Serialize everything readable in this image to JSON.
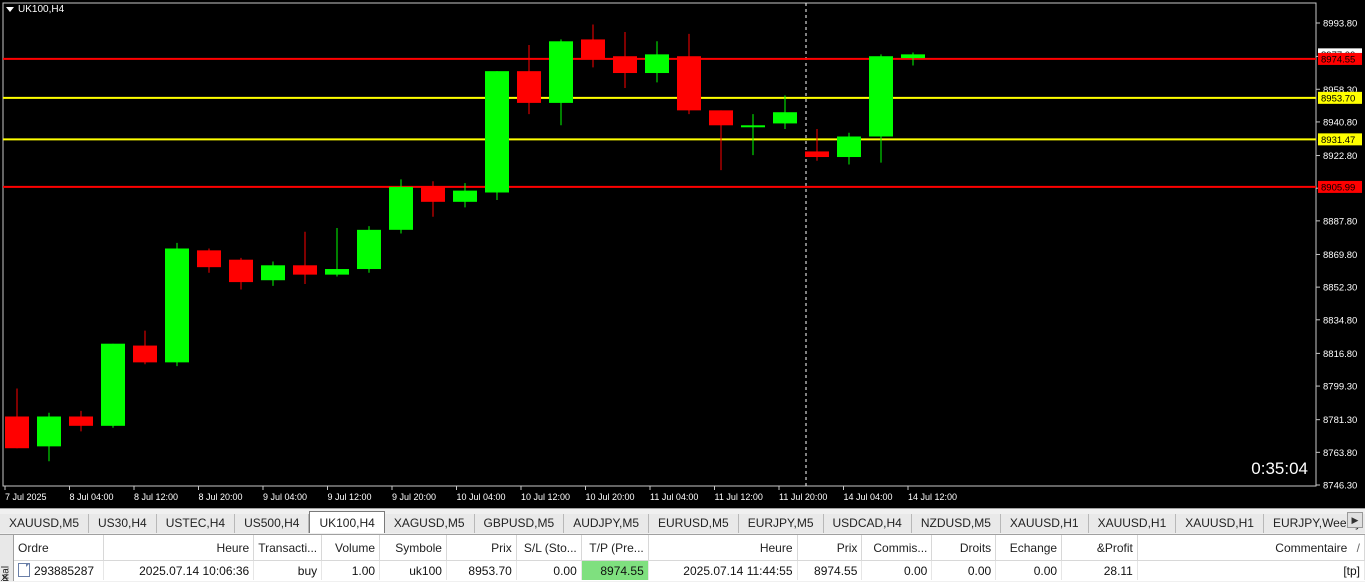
{
  "chart": {
    "symbol_label": "UK100,H4",
    "countdown": "0:35:04",
    "colors": {
      "background": "#000000",
      "bull": "#00ff00",
      "bear": "#ff0000",
      "grid_text": "#ffffff",
      "red_level": "#ff0000",
      "yellow_level": "#ffff00"
    }
  },
  "chart_data": {
    "type": "candlestick",
    "title": "UK100,H4",
    "y_ticks": [
      "8993.80",
      "8975.90",
      "8958.30",
      "8940.80",
      "8922.80",
      "8905.30",
      "8887.80",
      "8869.80",
      "8852.30",
      "8834.80",
      "8816.80",
      "8799.30",
      "8781.30",
      "8763.80",
      "8746.30"
    ],
    "x_labels": [
      "7 Jul 2025",
      "8 Jul 04:00",
      "8 Jul 12:00",
      "8 Jul 20:00",
      "9 Jul 04:00",
      "9 Jul 12:00",
      "9 Jul 20:00",
      "10 Jul 04:00",
      "10 Jul 12:00",
      "10 Jul 20:00",
      "11 Jul 04:00",
      "11 Jul 12:00",
      "11 Jul 20:00",
      "14 Jul 04:00",
      "14 Jul 12:00"
    ],
    "price_labels": [
      {
        "text": "8974.55",
        "color": "#ff0000",
        "value": 8974.55
      },
      {
        "text": "8953.70",
        "color": "#ffff00",
        "value": 8953.7
      },
      {
        "text": "8931.47",
        "color": "#ffff00",
        "value": 8931.47
      },
      {
        "text": "8905.99",
        "color": "#ff0000",
        "value": 8905.99
      }
    ],
    "horizontal_lines": [
      {
        "value": 8974.55,
        "color": "#ff0000"
      },
      {
        "value": 8953.7,
        "color": "#ffff00"
      },
      {
        "value": 8931.47,
        "color": "#ffff00"
      },
      {
        "value": 8905.99,
        "color": "#ff0000"
      }
    ],
    "candles": [
      {
        "o": 8783,
        "h": 8798,
        "l": 8766,
        "c": 8766
      },
      {
        "o": 8767,
        "h": 8785,
        "l": 8759,
        "c": 8783
      },
      {
        "o": 8783,
        "h": 8786,
        "l": 8775,
        "c": 8778
      },
      {
        "o": 8778,
        "h": 8822,
        "l": 8777,
        "c": 8822
      },
      {
        "o": 8821,
        "h": 8829,
        "l": 8811,
        "c": 8812
      },
      {
        "o": 8812,
        "h": 8876,
        "l": 8810,
        "c": 8873
      },
      {
        "o": 8872,
        "h": 8873,
        "l": 8860,
        "c": 8863
      },
      {
        "o": 8867,
        "h": 8868,
        "l": 8851,
        "c": 8855
      },
      {
        "o": 8856,
        "h": 8866,
        "l": 8853,
        "c": 8864
      },
      {
        "o": 8864,
        "h": 8882,
        "l": 8854,
        "c": 8859
      },
      {
        "o": 8859,
        "h": 8884,
        "l": 8858,
        "c": 8862
      },
      {
        "o": 8862,
        "h": 8885,
        "l": 8860,
        "c": 8883
      },
      {
        "o": 8883,
        "h": 8910,
        "l": 8881,
        "c": 8906
      },
      {
        "o": 8906,
        "h": 8909,
        "l": 8890,
        "c": 8898
      },
      {
        "o": 8898,
        "h": 8908,
        "l": 8895,
        "c": 8904
      },
      {
        "o": 8903,
        "h": 8968,
        "l": 8899,
        "c": 8968
      },
      {
        "o": 8968,
        "h": 8982,
        "l": 8945,
        "c": 8951
      },
      {
        "o": 8951,
        "h": 8985,
        "l": 8939,
        "c": 8984
      },
      {
        "o": 8985,
        "h": 8993,
        "l": 8970,
        "c": 8975
      },
      {
        "o": 8976,
        "h": 8989,
        "l": 8959,
        "c": 8967
      },
      {
        "o": 8967,
        "h": 8984,
        "l": 8962,
        "c": 8977
      },
      {
        "o": 8976,
        "h": 8988,
        "l": 8945,
        "c": 8947
      },
      {
        "o": 8947,
        "h": 8947,
        "l": 8915,
        "c": 8939
      },
      {
        "o": 8938,
        "h": 8945,
        "l": 8923,
        "c": 8939
      },
      {
        "o": 8940,
        "h": 8955,
        "l": 8937,
        "c": 8946
      },
      {
        "o": 8925,
        "h": 8937,
        "l": 8920,
        "c": 8922
      },
      {
        "o": 8922,
        "h": 8935,
        "l": 8918,
        "c": 8933
      },
      {
        "o": 8933,
        "h": 8977,
        "l": 8919,
        "c": 8976
      },
      {
        "o": 8975,
        "h": 8978,
        "l": 8971,
        "c": 8977
      }
    ],
    "ylim": [
      8746.3,
      8993.8
    ],
    "current_price": 8977.0,
    "current_price_label": "8977.00"
  },
  "tabs": [
    "XAUUSD,M5",
    "US30,H4",
    "USTEC,H4",
    "US500,H4",
    "UK100,H4",
    "XAGUSD,M5",
    "GBPUSD,M5",
    "AUDJPY,M5",
    "EURUSD,M5",
    "EURJPY,M5",
    "USDCAD,H4",
    "NZDUSD,M5",
    "XAUUSD,H1",
    "XAUUSD,H1",
    "XAUUSD,H1",
    "EURJPY,Weekly"
  ],
  "active_tab": 4,
  "terminal": {
    "side_label": "inal",
    "columns": [
      "Ordre",
      "Heure",
      "Transacti...",
      "Volume",
      "Symbole",
      "Prix",
      "S/L (Sto...",
      "T/P (Pre...",
      "Heure",
      "Prix",
      "Commis...",
      "Droits",
      "Echange",
      "&Profit",
      "Commentaire"
    ],
    "sort_indicator": "/",
    "row": {
      "order": "293885287",
      "open_time": "2025.07.14 10:06:36",
      "type": "buy",
      "volume": "1.00",
      "symbol": "uk100",
      "open_price": "8953.70",
      "sl": "0.00",
      "tp": "8974.55",
      "close_time": "2025.07.14 11:44:55",
      "close_price": "8974.55",
      "commission": "0.00",
      "swap_rights": "0.00",
      "exchange": "0.00",
      "profit": "28.11",
      "comment": "[tp]"
    }
  }
}
